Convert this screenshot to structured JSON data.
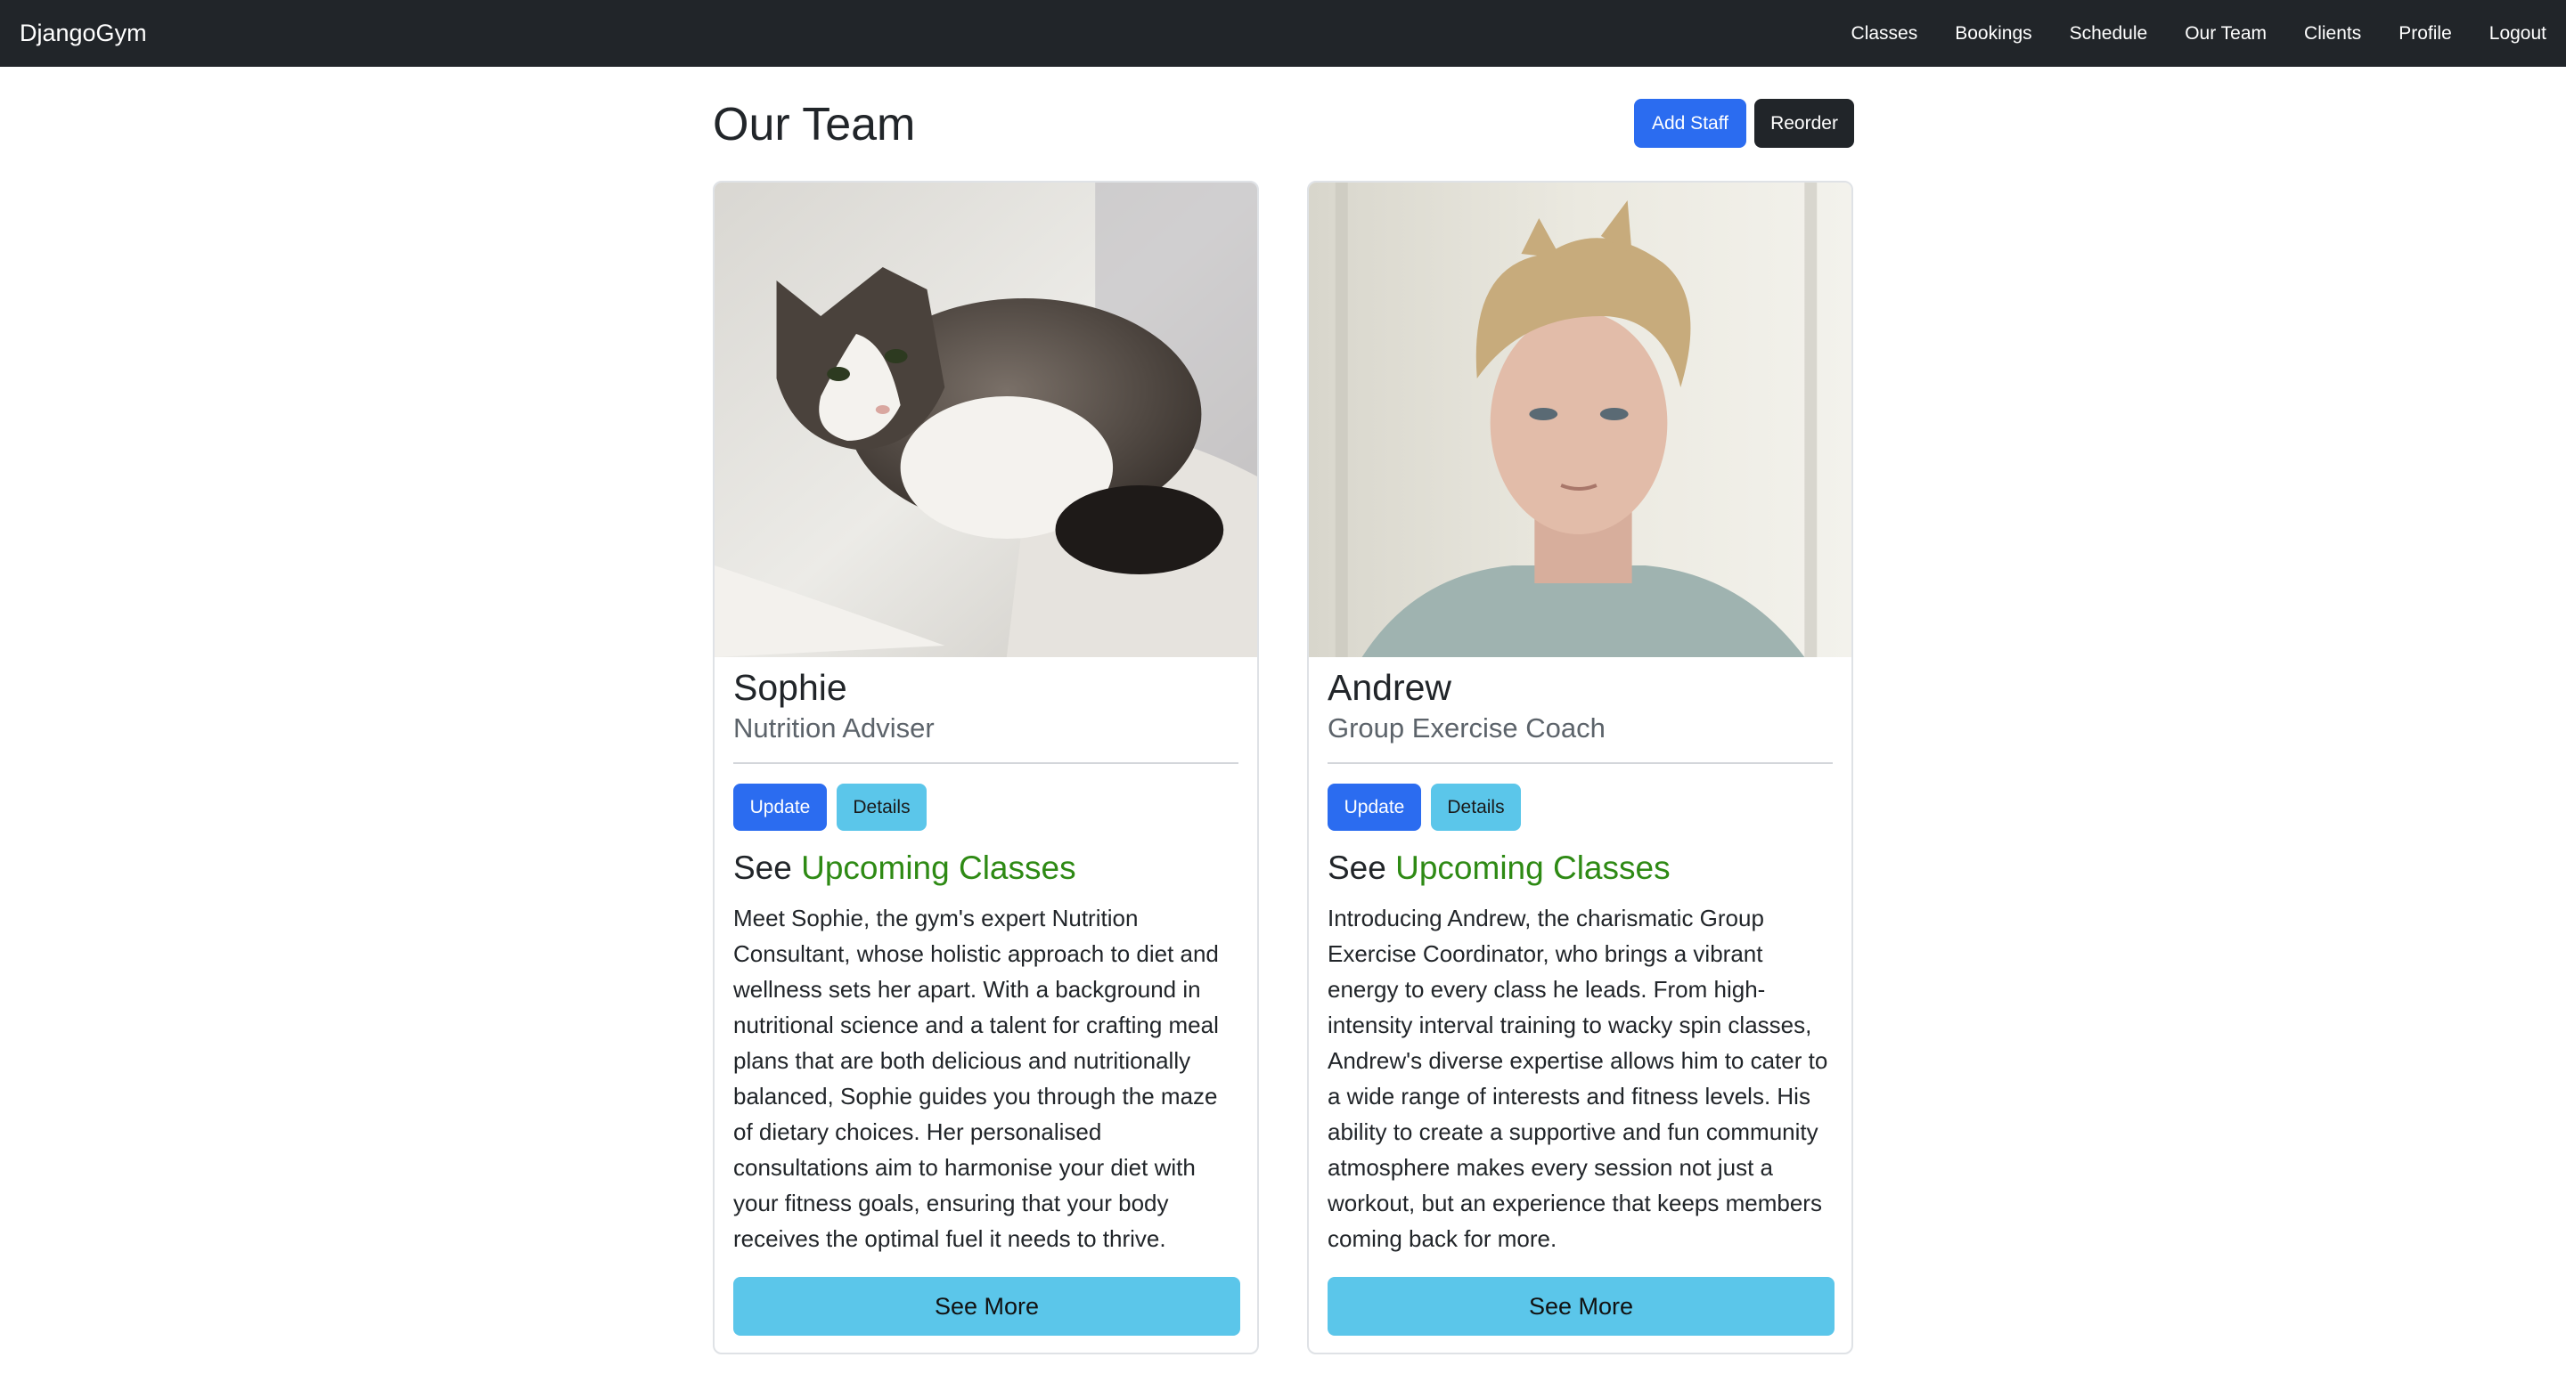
{
  "navbar": {
    "brand": "DjangoGym",
    "links": [
      "Classes",
      "Bookings",
      "Schedule",
      "Our Team",
      "Clients",
      "Profile",
      "Logout"
    ]
  },
  "page": {
    "title": "Our Team",
    "add_staff_label": "Add Staff",
    "reorder_label": "Reorder"
  },
  "staff": [
    {
      "name": "Sophie",
      "role": "Nutrition Adviser",
      "photo": "cat-photo",
      "update_label": "Update",
      "details_label": "Details",
      "see_label": "See",
      "upcoming_label": "Upcoming Classes",
      "bio": "Meet Sophie, the gym's expert Nutrition Consultant, whose holistic approach to diet and wellness sets her apart. With a background in nutritional science and a talent for crafting meal plans that are both delicious and nutritionally balanced, Sophie guides you through the maze of dietary choices. Her personalised consultations aim to harmonise your diet with your fitness goals, ensuring that your body receives the optimal fuel it needs to thrive.",
      "see_more_label": "See More"
    },
    {
      "name": "Andrew",
      "role": "Group Exercise Coach",
      "photo": "portrait-photo",
      "update_label": "Update",
      "details_label": "Details",
      "see_label": "See",
      "upcoming_label": "Upcoming Classes",
      "bio": "Introducing Andrew, the charismatic Group Exercise Coordinator, who brings a vibrant energy to every class he leads. From high-intensity interval training to wacky spin classes, Andrew's diverse expertise allows him to cater to a wide range of interests and fitness levels. His ability to create a supportive and fun community atmosphere makes every session not just a workout, but an experience that keeps members coming back for more.",
      "see_more_label": "See More"
    }
  ],
  "colors": {
    "navbar_bg": "#212529",
    "primary": "#2b6cf0",
    "info": "#5bc6ea",
    "link_green": "#2e8a14"
  }
}
